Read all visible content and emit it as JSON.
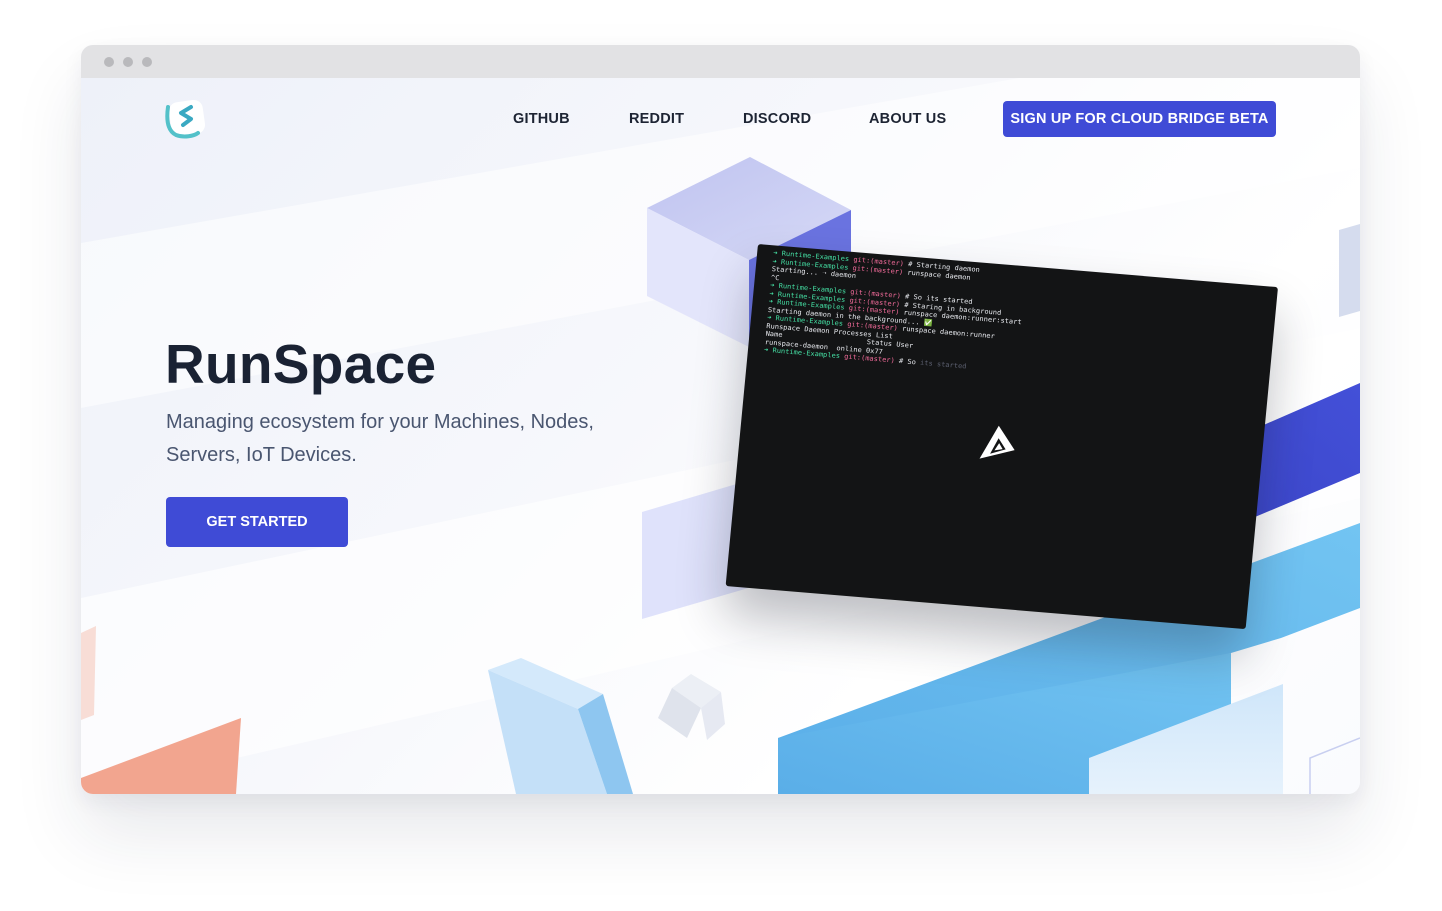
{
  "window": {
    "controls": [
      "close-dot",
      "minimize-dot",
      "maximize-dot"
    ]
  },
  "nav": {
    "logo": "runspace-logo",
    "links": [
      {
        "label": "GITHUB"
      },
      {
        "label": "REDDIT"
      },
      {
        "label": "DISCORD"
      },
      {
        "label": "ABOUT US"
      }
    ],
    "cta_label": "SIGN UP FOR CLOUD BRIDGE BETA"
  },
  "hero": {
    "title": "RunSpace",
    "subtitle": "Managing ecosystem for your Machines, Nodes, Servers, IoT Devices.",
    "cta_label": "GET STARTED"
  },
  "terminal": {
    "lines": [
      {
        "arrow": "➜",
        "dir": "Runtime-Examples",
        "git": "git:(master)",
        "cmd": "# Starting daemon"
      },
      {
        "arrow": "➜",
        "dir": "Runtime-Examples",
        "git": "git:(master)",
        "cmd": "runspace daemon"
      },
      {
        "plain": "Starting... ➝ daemon"
      },
      {
        "plain": "^C"
      },
      {
        "arrow": "➜",
        "dir": "Runtime-Examples",
        "git": "git:(master)",
        "cmd": "# So its started"
      },
      {
        "arrow": "➜",
        "dir": "Runtime-Examples",
        "git": "git:(master)",
        "cmd": "# Staring in background"
      },
      {
        "arrow": "➜",
        "dir": "Runtime-Examples",
        "git": "git:(master)",
        "cmd": "runspace daemon:runner:start"
      },
      {
        "plain": "Starting daemon in the background... ✅"
      },
      {
        "arrow": "➜",
        "dir": "Runtime-Examples",
        "git": "git:(master)",
        "cmd": "runspace daemon:runner"
      },
      {
        "plain": "Runspace Daemon Processes List"
      },
      {
        "plain": "Name                    Status User"
      },
      {
        "plain": "runspace-daemon  online 0x77"
      },
      {
        "arrow": "➜",
        "dir": "Runtime-Examples",
        "git": "git:(master)",
        "cmd": "# So",
        "dim": "its started"
      }
    ],
    "overlay_icon": "play-triangle-icon"
  },
  "colors": {
    "accent": "#3f4bd6",
    "title": "#1a2233",
    "subtitle": "#4a5670",
    "terminal_bg": "#131415",
    "shape_blue": "#5cb4ea",
    "shape_indigo": "#3d47cc",
    "shape_salmon": "#f4a894",
    "shape_lavender": "#c5c9f2"
  }
}
